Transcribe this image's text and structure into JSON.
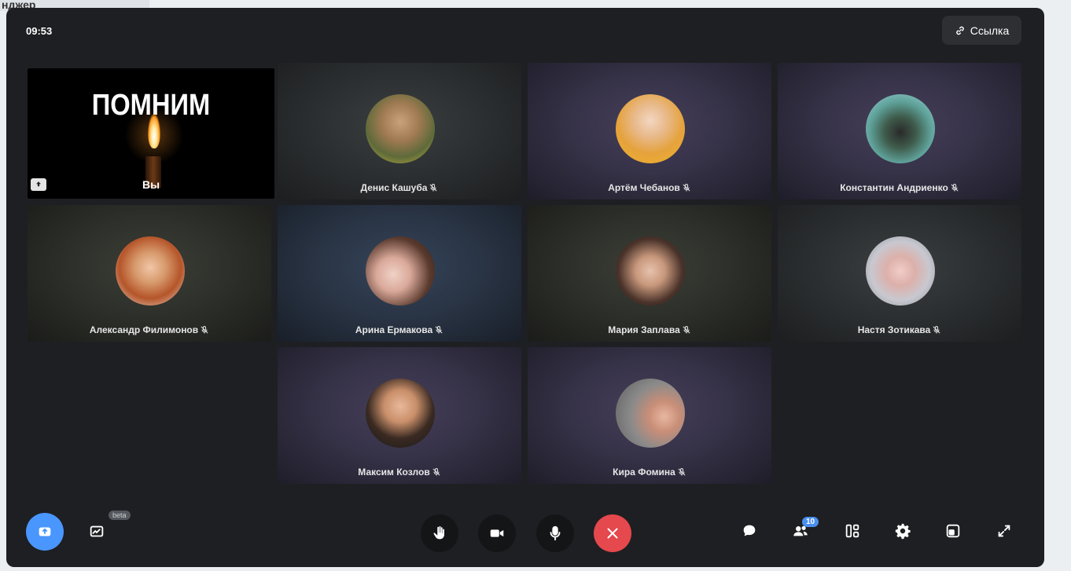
{
  "header": {
    "time": "09:53",
    "link_label": "Ссылка"
  },
  "self_tile": {
    "overlay_text": "ПОМНИМ",
    "name": "Вы"
  },
  "participants": [
    {
      "name": "Денис Кашуба",
      "muted": true
    },
    {
      "name": "Артём Чебанов",
      "muted": true
    },
    {
      "name": "Константин Андриенко",
      "muted": true
    },
    {
      "name": "Александр Филимонов",
      "muted": true
    },
    {
      "name": "Арина Ермакова",
      "muted": true
    },
    {
      "name": "Мария Заплава",
      "muted": true
    },
    {
      "name": "Настя Зотикава",
      "muted": true
    },
    {
      "name": "Максим Козлов",
      "muted": true
    },
    {
      "name": "Кира Фомина",
      "muted": true
    }
  ],
  "controls": {
    "left": [
      "share-screen-icon",
      "whiteboard-icon"
    ],
    "center": [
      "raise-hand-icon",
      "camera-icon",
      "microphone-icon",
      "end-call-icon"
    ],
    "right": [
      "chat-icon",
      "participants-icon",
      "layout-icon",
      "settings-icon",
      "picture-in-picture-icon",
      "fullscreen-icon"
    ]
  },
  "beta_label": "beta",
  "participants_count": "10",
  "background_page": {
    "visible_text": "нджер"
  },
  "colors": {
    "end_call": "#e5484d",
    "share_active": "#4a96ff",
    "badge": "#4a8fef"
  }
}
